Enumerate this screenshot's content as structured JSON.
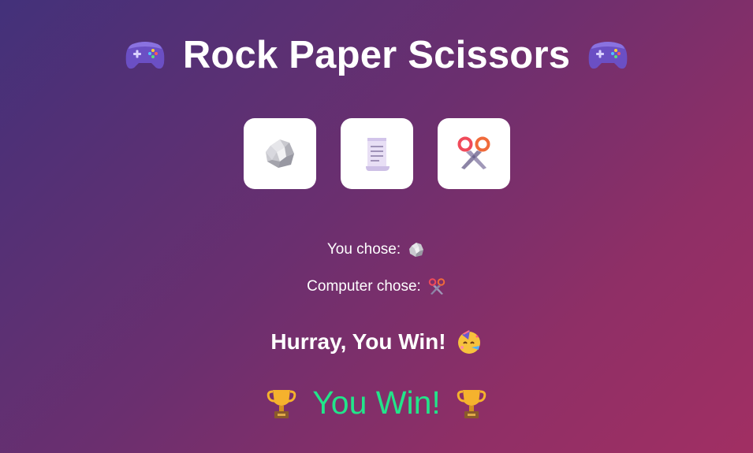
{
  "header": {
    "title": "Rock Paper Scissors",
    "left_icon": "game-controller-icon",
    "right_icon": "game-controller-icon"
  },
  "choices": [
    {
      "name": "rock",
      "icon": "rock-icon"
    },
    {
      "name": "paper",
      "icon": "paper-icon"
    },
    {
      "name": "scissors",
      "icon": "scissors-icon"
    }
  ],
  "status": {
    "you_chose_label": "You chose:",
    "you_chose_icon": "rock-icon",
    "computer_chose_label": "Computer chose:",
    "computer_chose_icon": "scissors-icon",
    "result_message": "Hurray, You Win!",
    "result_icon": "partying-face-icon",
    "final_result": "You Win!",
    "final_icon": "trophy-icon"
  },
  "colors": {
    "background_start": "#43317a",
    "background_end": "#a12f63",
    "win_text": "#22e58a",
    "button_bg": "#ffffff"
  }
}
